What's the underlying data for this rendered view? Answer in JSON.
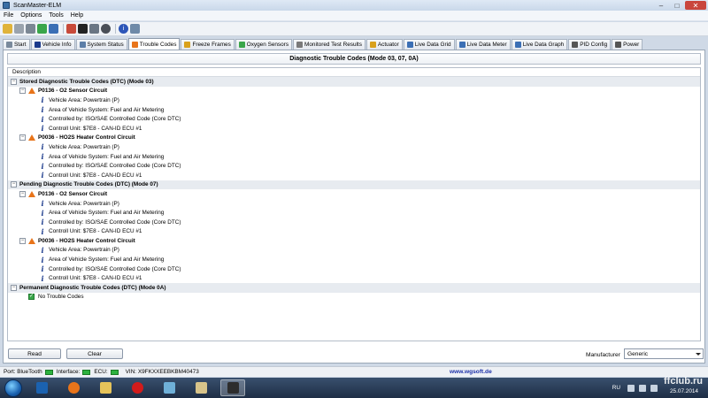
{
  "window": {
    "title": "ScanMaster-ELM",
    "min": "–",
    "max": "□",
    "close": "✕"
  },
  "menu": [
    "File",
    "Options",
    "Tools",
    "Help"
  ],
  "tabs": [
    {
      "label": "Start",
      "icon": "wrench-icon",
      "color": "#7a8a9c"
    },
    {
      "label": "Vehicle Info",
      "icon": "info-icon",
      "color": "#1c3b8c"
    },
    {
      "label": "System Status",
      "icon": "status-icon",
      "color": "#5d7fa8"
    },
    {
      "label": "Trouble Codes",
      "icon": "warning-icon",
      "color": "#e8741a",
      "active": true
    },
    {
      "label": "Freeze Frames",
      "icon": "snowflake-icon",
      "color": "#d9a11c"
    },
    {
      "label": "Oxygen Sensors",
      "icon": "oxygen-icon",
      "color": "#3aa64a"
    },
    {
      "label": "Monitored Test Results",
      "icon": "gear-icon",
      "color": "#7a7a7a"
    },
    {
      "label": "Actuator",
      "icon": "actuator-icon",
      "color": "#d9a11c"
    },
    {
      "label": "Live Data Grid",
      "icon": "grid-icon",
      "color": "#3b6fb5"
    },
    {
      "label": "Live Data Meter",
      "icon": "meter-icon",
      "color": "#3b6fb5"
    },
    {
      "label": "Live Data Graph",
      "icon": "graph-icon",
      "color": "#3b6fb5"
    },
    {
      "label": "PID Config",
      "icon": "config-icon",
      "color": "#555555"
    },
    {
      "label": "Power",
      "icon": "power-icon",
      "color": "#555555"
    }
  ],
  "panel": {
    "title": "Diagnostic Trouble Codes (Mode 03, 07, 0A)",
    "column_header": "Description"
  },
  "tree": {
    "groups": [
      {
        "label": "Stored Diagnostic Trouble Codes (DTC) (Mode 03)",
        "codes": [
          {
            "label": "P0136 - O2 Sensor Circuit",
            "details": [
              "Vehicle Area: Powertrain (P)",
              "Area of Vehicle System: Fuel and Air Metering",
              "Controlled by: ISO/SAE Controlled Code (Core DTC)",
              "Controll Unit: $7E8 - CAN-ID ECU #1"
            ]
          },
          {
            "label": "P0036 - HO2S Heater Control Circuit",
            "details": [
              "Vehicle Area: Powertrain (P)",
              "Area of Vehicle System: Fuel and Air Metering",
              "Controlled by: ISO/SAE Controlled Code (Core DTC)",
              "Controll Unit: $7E8 - CAN-ID ECU #1"
            ]
          }
        ]
      },
      {
        "label": "Pending Diagnostic Trouble Codes (DTC) (Mode 07)",
        "codes": [
          {
            "label": "P0136 - O2 Sensor Circuit",
            "details": [
              "Vehicle Area: Powertrain (P)",
              "Area of Vehicle System: Fuel and Air Metering",
              "Controlled by: ISO/SAE Controlled Code (Core DTC)",
              "Controll Unit: $7E8 - CAN-ID ECU #1"
            ]
          },
          {
            "label": "P0036 - HO2S Heater Control Circuit",
            "details": [
              "Vehicle Area: Powertrain (P)",
              "Area of Vehicle System: Fuel and Air Metering",
              "Controlled by: ISO/SAE Controlled Code (Core DTC)",
              "Controll Unit: $7E8 - CAN-ID ECU #1"
            ]
          }
        ]
      },
      {
        "label": "Permanent Diagnostic Trouble Codes (DTC) (Mode 0A)",
        "none_label": "No Trouble Codes"
      }
    ]
  },
  "buttons": {
    "read": "Read",
    "clear": "Clear"
  },
  "manufacturer": {
    "label": "Manufacturer",
    "value": "Generic"
  },
  "status": {
    "port_label": "Port:",
    "port_value": "BlueTooth",
    "interface_label": "Interface:",
    "ecu_label": "ECU:",
    "vin": "VIN: X9FKXXEEBKBM40473",
    "url": "www.wgsoft.de",
    "led_color": "#2db23f"
  },
  "taskbar": {
    "lang": "RU",
    "date": "25.07.2014",
    "watermark": "ffclub.ru"
  }
}
